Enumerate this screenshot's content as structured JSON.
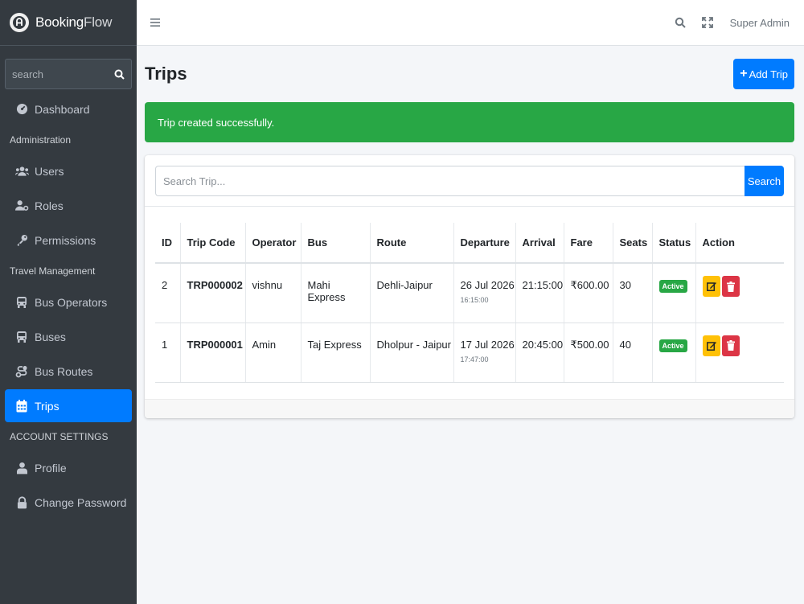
{
  "brand": {
    "name_bold": "Booking",
    "name_light": "Flow"
  },
  "sidebar": {
    "search_placeholder": "search",
    "items": [
      {
        "type": "item",
        "label": "Dashboard",
        "icon": "dashboard-icon"
      },
      {
        "type": "header",
        "label": "Administration"
      },
      {
        "type": "item",
        "label": "Users",
        "icon": "users-icon"
      },
      {
        "type": "item",
        "label": "Roles",
        "icon": "roles-icon"
      },
      {
        "type": "item",
        "label": "Permissions",
        "icon": "key-icon"
      },
      {
        "type": "header",
        "label": "Travel Management"
      },
      {
        "type": "item",
        "label": "Bus Operators",
        "icon": "bus-icon"
      },
      {
        "type": "item",
        "label": "Buses",
        "icon": "bus-icon"
      },
      {
        "type": "item",
        "label": "Bus Routes",
        "icon": "route-icon"
      },
      {
        "type": "item",
        "label": "Trips",
        "icon": "calendar-icon",
        "active": true
      },
      {
        "type": "header",
        "label": "ACCOUNT SETTINGS"
      },
      {
        "type": "item",
        "label": "Profile",
        "icon": "user-icon"
      },
      {
        "type": "item",
        "label": "Change Password",
        "icon": "lock-icon"
      }
    ]
  },
  "topbar": {
    "user_name": "Super Admin"
  },
  "page": {
    "title": "Trips",
    "add_button": "Add Trip",
    "alert": "Trip created successfully.",
    "search_placeholder": "Search Trip...",
    "search_button": "Search"
  },
  "table": {
    "headers": [
      "ID",
      "Trip Code",
      "Operator",
      "Bus",
      "Route",
      "Departure",
      "Arrival",
      "Fare",
      "Seats",
      "Status",
      "Action"
    ],
    "rows": [
      {
        "id": "2",
        "code": "TRP000002",
        "operator": "vishnu",
        "bus": "Mahi Express",
        "route": "Dehli-Jaipur",
        "departure_date": "26 Jul 2026",
        "departure_time": "16:15:00",
        "arrival": "21:15:00",
        "fare": "₹600.00",
        "seats": "30",
        "status": "Active"
      },
      {
        "id": "1",
        "code": "TRP000001",
        "operator": "Amin",
        "bus": "Taj Express",
        "route": "Dholpur - Jaipur",
        "departure_date": "17 Jul 2026",
        "departure_time": "17:47:00",
        "arrival": "20:45:00",
        "fare": "₹500.00",
        "seats": "40",
        "status": "Active"
      }
    ]
  },
  "colors": {
    "primary": "#007bff",
    "success": "#28a745",
    "warning": "#ffc107",
    "danger": "#dc3545",
    "sidebar": "#343a40"
  }
}
